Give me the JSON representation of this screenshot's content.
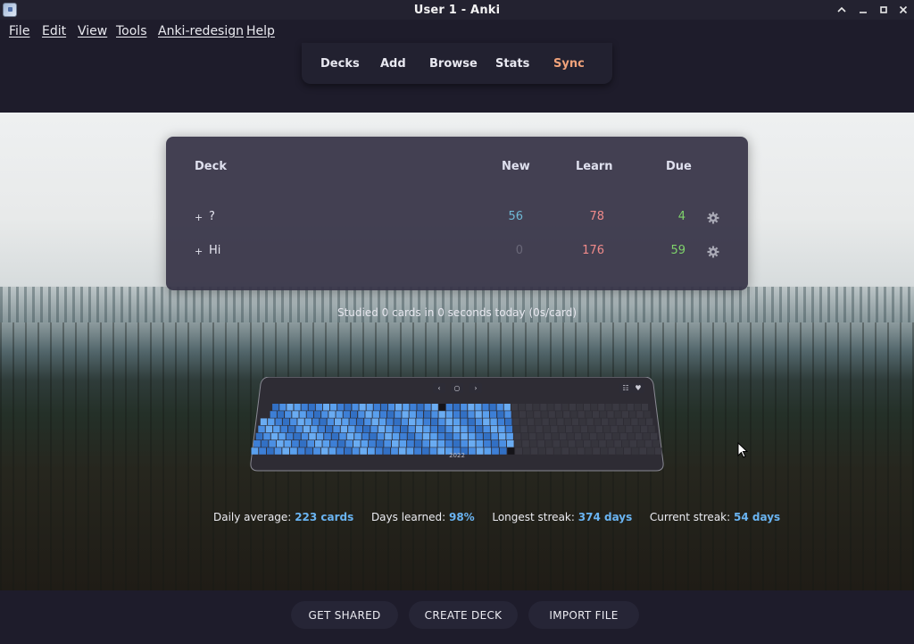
{
  "window": {
    "title": "User 1 - Anki"
  },
  "menu": [
    "File",
    "Edit",
    "View",
    "Tools",
    "Anki-redesign",
    "Help"
  ],
  "toolbar": {
    "decks": "Decks",
    "add": "Add",
    "browse": "Browse",
    "stats": "Stats",
    "sync": "Sync"
  },
  "deck_table": {
    "headers": {
      "deck": "Deck",
      "new": "New",
      "learn": "Learn",
      "due": "Due"
    },
    "rows": [
      {
        "expand": "+",
        "name": "?",
        "new": "56",
        "learn": "78",
        "due": "4"
      },
      {
        "expand": "+",
        "name": "Hi",
        "new": "0",
        "learn": "176",
        "due": "59"
      }
    ]
  },
  "studied_text": "Studied 0 cards in 0 seconds today (0s/card)",
  "heatmap": {
    "year": "2022"
  },
  "stats": {
    "daily_average_label": "Daily average:",
    "daily_average_value": "223 cards",
    "days_learned_label": "Days learned:",
    "days_learned_value": "98%",
    "longest_streak_label": "Longest streak:",
    "longest_streak_value": "374 days",
    "current_streak_label": "Current streak:",
    "current_streak_value": "54 days"
  },
  "bottom_buttons": {
    "get_shared": "GET SHARED",
    "create_deck": "CREATE DECK",
    "import_file": "IMPORT FILE"
  },
  "colors": {
    "accent_blue": "#6ab4f2",
    "sync_orange": "#f0a27a",
    "learn_red": "#f08a8a",
    "due_green": "#7fd36b",
    "new_blue": "#6fb9d6"
  }
}
